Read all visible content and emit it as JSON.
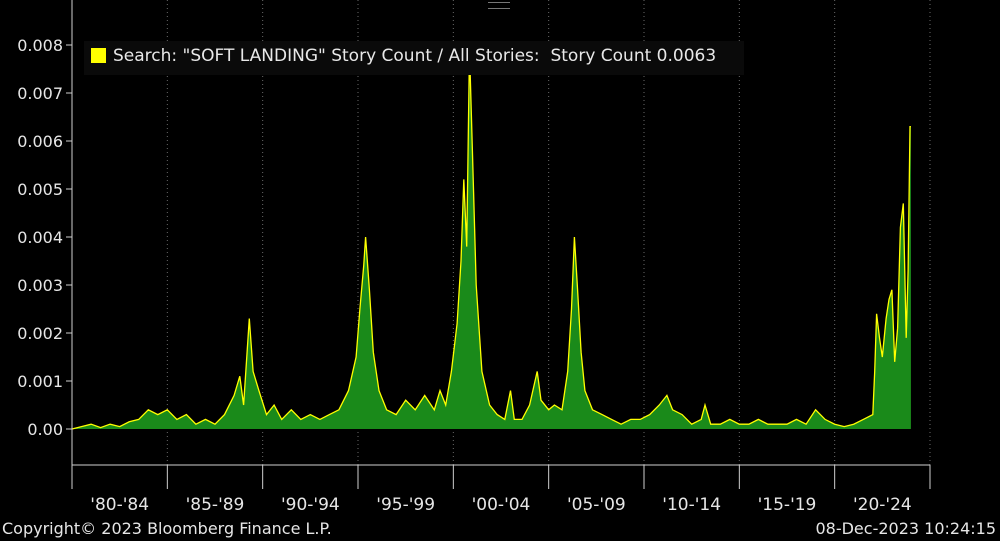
{
  "chart_data": {
    "type": "area",
    "legend": {
      "label": "Search: \"SOFT LANDING\" Story Count / All Stories:",
      "series_name": "Story Count",
      "last_value": "0.0063",
      "color": "#ffff00",
      "placement": "top-left"
    },
    "fill_color": "#1a8a1a",
    "line_color": "#ffff00",
    "ylim": [
      0,
      0.008
    ],
    "yticks": [
      "0.00",
      "0.001",
      "0.002",
      "0.003",
      "0.004",
      "0.005",
      "0.006",
      "0.007",
      "0.008"
    ],
    "xlim": [
      1980,
      2025
    ],
    "xtick_labels": [
      "'80-'84",
      "'85-'89",
      "'90-'94",
      "'95-'99",
      "'00-'04",
      "'05-'09",
      "'10-'14",
      "'15-'19",
      "'20-'24"
    ],
    "grid": "vertical dotted",
    "series": [
      {
        "name": "Story Count",
        "points": [
          [
            1980.0,
            0.0
          ],
          [
            1980.5,
            5e-05
          ],
          [
            1981.0,
            0.0001
          ],
          [
            1981.5,
            3e-05
          ],
          [
            1982.0,
            0.0001
          ],
          [
            1982.5,
            5e-05
          ],
          [
            1983.0,
            0.00015
          ],
          [
            1983.5,
            0.0002
          ],
          [
            1984.0,
            0.0004
          ],
          [
            1984.5,
            0.0003
          ],
          [
            1985.0,
            0.0004
          ],
          [
            1985.5,
            0.0002
          ],
          [
            1986.0,
            0.0003
          ],
          [
            1986.5,
            0.0001
          ],
          [
            1987.0,
            0.0002
          ],
          [
            1987.5,
            0.0001
          ],
          [
            1988.0,
            0.0003
          ],
          [
            1988.5,
            0.0007
          ],
          [
            1988.8,
            0.0011
          ],
          [
            1989.0,
            0.0005
          ],
          [
            1989.3,
            0.0023
          ],
          [
            1989.5,
            0.0012
          ],
          [
            1989.8,
            0.0008
          ],
          [
            1990.2,
            0.0003
          ],
          [
            1990.6,
            0.0005
          ],
          [
            1991.0,
            0.0002
          ],
          [
            1991.5,
            0.0004
          ],
          [
            1992.0,
            0.0002
          ],
          [
            1992.5,
            0.0003
          ],
          [
            1993.0,
            0.0002
          ],
          [
            1993.5,
            0.0003
          ],
          [
            1994.0,
            0.0004
          ],
          [
            1994.5,
            0.0008
          ],
          [
            1994.9,
            0.0015
          ],
          [
            1995.1,
            0.0025
          ],
          [
            1995.3,
            0.0034
          ],
          [
            1995.4,
            0.004
          ],
          [
            1995.6,
            0.0029
          ],
          [
            1995.8,
            0.0016
          ],
          [
            1996.1,
            0.0008
          ],
          [
            1996.5,
            0.0004
          ],
          [
            1997.0,
            0.0003
          ],
          [
            1997.5,
            0.0006
          ],
          [
            1998.0,
            0.0004
          ],
          [
            1998.5,
            0.0007
          ],
          [
            1999.0,
            0.0004
          ],
          [
            1999.3,
            0.0008
          ],
          [
            1999.6,
            0.0005
          ],
          [
            1999.9,
            0.0012
          ],
          [
            2000.2,
            0.0022
          ],
          [
            2000.4,
            0.0035
          ],
          [
            2000.55,
            0.0052
          ],
          [
            2000.7,
            0.0038
          ],
          [
            2000.85,
            0.0079
          ],
          [
            2001.0,
            0.0058
          ],
          [
            2001.2,
            0.003
          ],
          [
            2001.5,
            0.0012
          ],
          [
            2001.9,
            0.0005
          ],
          [
            2002.3,
            0.0003
          ],
          [
            2002.7,
            0.0002
          ],
          [
            2003.0,
            0.0008
          ],
          [
            2003.2,
            0.0002
          ],
          [
            2003.6,
            0.0002
          ],
          [
            2004.0,
            0.0005
          ],
          [
            2004.4,
            0.0012
          ],
          [
            2004.6,
            0.0006
          ],
          [
            2005.0,
            0.0004
          ],
          [
            2005.3,
            0.0005
          ],
          [
            2005.7,
            0.0004
          ],
          [
            2006.0,
            0.0012
          ],
          [
            2006.2,
            0.0025
          ],
          [
            2006.35,
            0.004
          ],
          [
            2006.5,
            0.003
          ],
          [
            2006.7,
            0.0016
          ],
          [
            2006.9,
            0.0008
          ],
          [
            2007.3,
            0.0004
          ],
          [
            2007.8,
            0.0003
          ],
          [
            2008.3,
            0.0002
          ],
          [
            2008.8,
            0.0001
          ],
          [
            2009.3,
            0.0002
          ],
          [
            2009.8,
            0.0002
          ],
          [
            2010.3,
            0.0003
          ],
          [
            2010.8,
            0.0005
          ],
          [
            2011.2,
            0.0007
          ],
          [
            2011.5,
            0.0004
          ],
          [
            2012.0,
            0.0003
          ],
          [
            2012.5,
            0.0001
          ],
          [
            2013.0,
            0.0002
          ],
          [
            2013.2,
            0.0005
          ],
          [
            2013.5,
            0.0001
          ],
          [
            2014.0,
            0.0001
          ],
          [
            2014.5,
            0.0002
          ],
          [
            2015.0,
            0.0001
          ],
          [
            2015.5,
            0.0001
          ],
          [
            2016.0,
            0.0002
          ],
          [
            2016.5,
            0.0001
          ],
          [
            2017.0,
            0.0001
          ],
          [
            2017.5,
            0.0001
          ],
          [
            2018.0,
            0.0002
          ],
          [
            2018.5,
            0.0001
          ],
          [
            2019.0,
            0.0004
          ],
          [
            2019.5,
            0.0002
          ],
          [
            2020.0,
            0.0001
          ],
          [
            2020.5,
            5e-05
          ],
          [
            2021.0,
            0.0001
          ],
          [
            2021.5,
            0.0002
          ],
          [
            2022.0,
            0.0003
          ],
          [
            2022.1,
            0.0012
          ],
          [
            2022.2,
            0.0024
          ],
          [
            2022.35,
            0.0019
          ],
          [
            2022.5,
            0.0015
          ],
          [
            2022.7,
            0.0023
          ],
          [
            2022.85,
            0.0027
          ],
          [
            2023.0,
            0.0029
          ],
          [
            2023.15,
            0.0014
          ],
          [
            2023.3,
            0.0021
          ],
          [
            2023.45,
            0.0042
          ],
          [
            2023.6,
            0.0047
          ],
          [
            2023.75,
            0.0019
          ],
          [
            2023.85,
            0.0033
          ],
          [
            2023.95,
            0.0063
          ],
          [
            2024.0,
            0.0063
          ]
        ]
      }
    ]
  },
  "footer": {
    "copyright": "Copyright© 2023 Bloomberg Finance L.P.",
    "timestamp": "08-Dec-2023 10:24:15"
  }
}
